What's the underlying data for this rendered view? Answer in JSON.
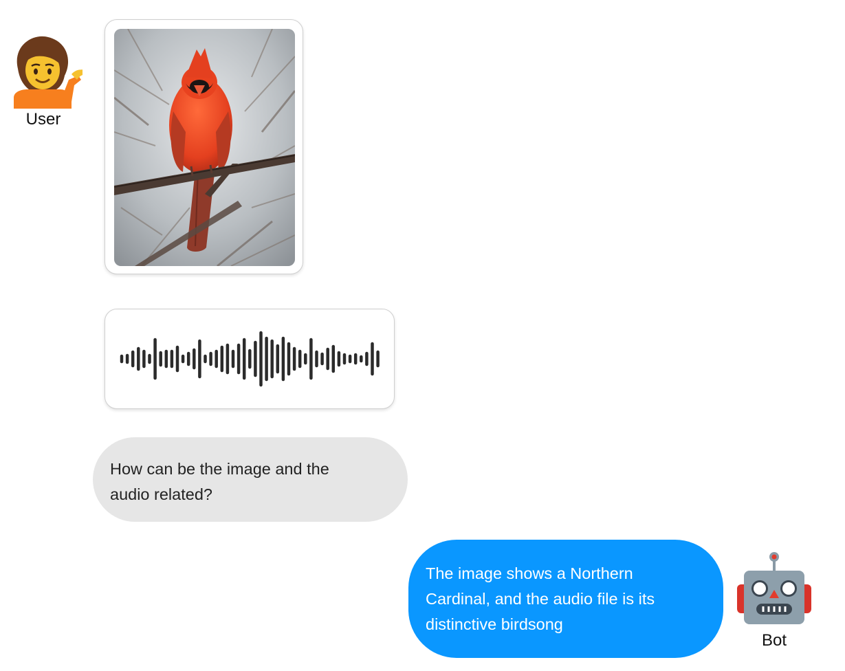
{
  "conversation": {
    "user": {
      "label": "User",
      "avatar_icon": "person-tipping-hand-emoji"
    },
    "bot": {
      "label": "Bot",
      "avatar_icon": "robot-emoji"
    },
    "messages": [
      {
        "role": "user",
        "type": "image",
        "content_icon": "northern-cardinal-photo"
      },
      {
        "role": "user",
        "type": "audio",
        "content_icon": "audio-waveform"
      },
      {
        "role": "user",
        "type": "text",
        "text": "How can be the image and the audio related?"
      },
      {
        "role": "bot",
        "type": "text",
        "text": "The image shows a Northern Cardinal, and the audio file is its distinctive birdsong"
      }
    ]
  },
  "colors": {
    "user_bubble": "#e6e6e6",
    "bot_bubble": "#0a97ff",
    "waveform": "#2b2b2b"
  }
}
